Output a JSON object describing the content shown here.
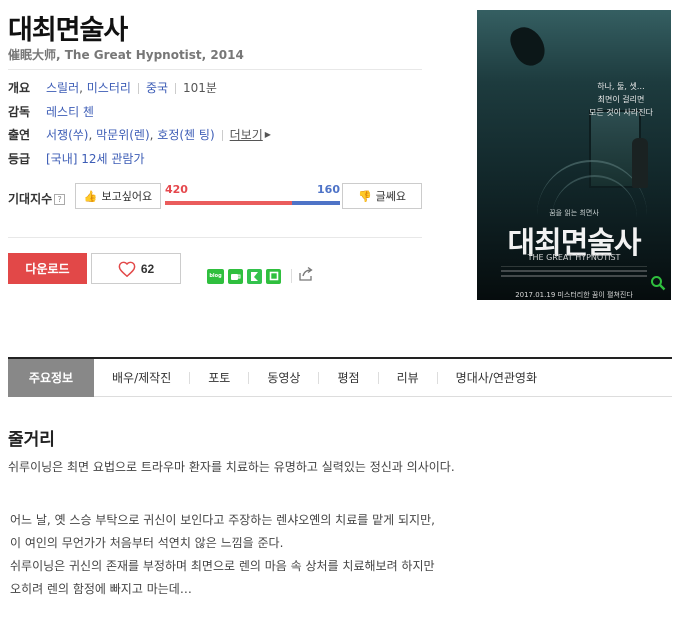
{
  "movie": {
    "title": "대최면술사",
    "subtitle": "催眠大师, The Great Hypnotist, 2014"
  },
  "info": {
    "overview_label": "개요",
    "genre1": "스릴러",
    "genre2": "미스터리",
    "country": "중국",
    "runtime": "101분",
    "director_label": "감독",
    "director": "레스티 첸",
    "cast_label": "출연",
    "cast1": "서쟁(쑤)",
    "cast2": "막문위(렌)",
    "cast3": "호정(첸 팅)",
    "cast_more": "더보기",
    "rating_label": "등급",
    "rating": "[국내] 12세 관람가"
  },
  "expect": {
    "label": "기대지수",
    "help": "?",
    "want_label": "보고싶어요",
    "meh_label": "글쎄요",
    "want_count": "420",
    "meh_count": "160",
    "want_ratio": 0.724
  },
  "actions": {
    "download_label": "다운로드",
    "like_count": "62"
  },
  "share": {
    "blog": "blog",
    "cafe": "cafe",
    "band": "band",
    "line": "line"
  },
  "poster": {
    "tagline1": "하나, 둘, 셋…",
    "tagline2": "최면이 걸리면",
    "tagline3": "모든 것이 사라진다",
    "small_copy": "꿈을 읽는 최면사",
    "title": "대최면술사",
    "english": "THE GREAT HYPNOTIST",
    "date": "2017.01.19 미스터리한 꿈이 펼쳐진다"
  },
  "tabs": [
    "주요정보",
    "배우/제작진",
    "포토",
    "동영상",
    "평점",
    "리뷰",
    "명대사/연관영화"
  ],
  "synopsis": {
    "heading": "줄거리",
    "lead": "쉬루이닝은 최면 요법으로 트라우마 환자를 치료하는 유명하고 실력있는 정신과 의사이다.",
    "lines": [
      "어느 날, 옛 스승 부탁으로 귀신이 보인다고 주장하는 렌샤오옌의 치료를 맡게 되지만,",
      "이 여인의 무언가가 처음부터 석연치 않은 느낌을 준다.",
      "쉬루이닝은 귀신의 존재를 부정하며 최면으로 렌의 마음 속 상처를 치료해보려 하지만",
      "오히려 렌의 함정에 빠지고 마는데…"
    ]
  },
  "colors": {
    "accent_red": "#e24848",
    "accent_blue": "#4e73c7",
    "link_blue": "#3d5db6"
  }
}
